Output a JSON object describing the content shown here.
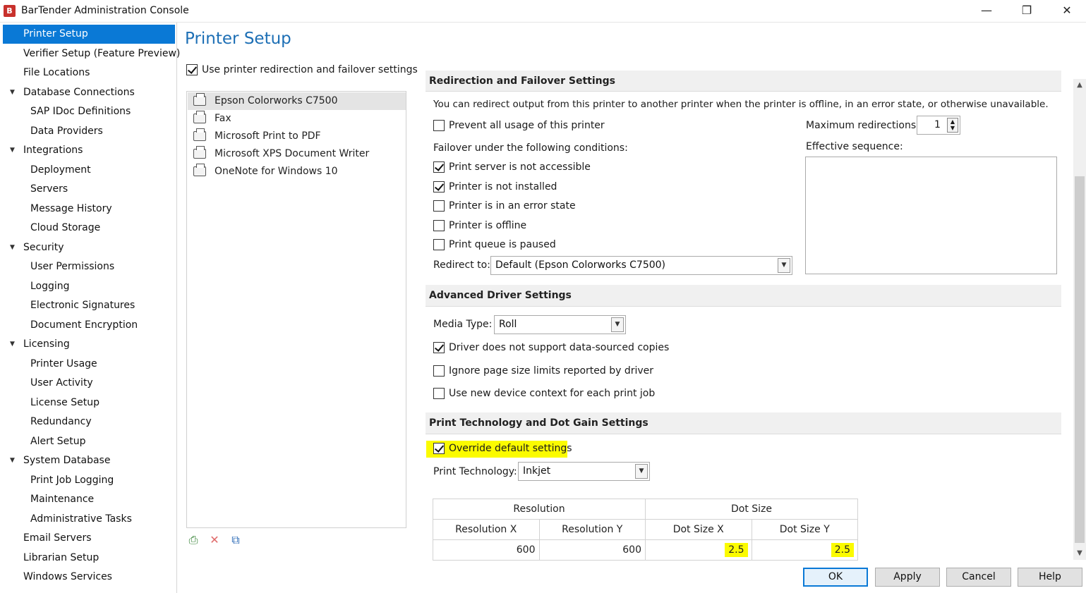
{
  "window": {
    "title": "BarTender Administration Console",
    "icon": "bartender-logo-icon",
    "controls": {
      "minimize": "—",
      "restore": "❐",
      "close": "✕"
    }
  },
  "sidebar": {
    "items": [
      {
        "label": "Printer Setup",
        "selected": true
      },
      {
        "label": "Verifier Setup (Feature Preview)"
      },
      {
        "label": "File Locations"
      },
      {
        "label": "Database Connections",
        "expanded": true
      },
      {
        "label": "SAP IDoc Definitions"
      },
      {
        "label": "Data Providers"
      },
      {
        "label": "Integrations",
        "expanded": true
      },
      {
        "label": "Deployment"
      },
      {
        "label": "Servers"
      },
      {
        "label": "Message History"
      },
      {
        "label": "Cloud Storage"
      },
      {
        "label": "Security",
        "expanded": true
      },
      {
        "label": "User Permissions"
      },
      {
        "label": "Logging"
      },
      {
        "label": "Electronic Signatures"
      },
      {
        "label": "Document Encryption"
      },
      {
        "label": "Licensing",
        "expanded": true
      },
      {
        "label": "Printer Usage"
      },
      {
        "label": "User Activity"
      },
      {
        "label": "License Setup"
      },
      {
        "label": "Redundancy"
      },
      {
        "label": "Alert Setup"
      },
      {
        "label": "System Database",
        "expanded": true
      },
      {
        "label": "Print Job Logging"
      },
      {
        "label": "Maintenance"
      },
      {
        "label": "Administrative Tasks"
      },
      {
        "label": "Email Servers"
      },
      {
        "label": "Librarian Setup"
      },
      {
        "label": "Windows Services"
      }
    ]
  },
  "main": {
    "title": "Printer Setup",
    "use_redirection_label": "Use printer redirection and failover settings",
    "use_redirection_checked": true,
    "printers": [
      {
        "name": "Epson Colorworks C7500",
        "selected": true
      },
      {
        "name": "Fax"
      },
      {
        "name": "Microsoft Print to PDF"
      },
      {
        "name": "Microsoft XPS Document Writer"
      },
      {
        "name": "OneNote for Windows 10"
      }
    ],
    "list_tools": {
      "add": "add-printer-icon",
      "delete": "delete-icon",
      "copy": "copy-icon"
    }
  },
  "redirection": {
    "header": "Redirection and Failover Settings",
    "description": "You can redirect output from this printer to another printer when the printer is offline, in an error state, or otherwise unavailable.",
    "prevent_label": "Prevent all usage of this printer",
    "prevent_checked": false,
    "max_redirections_label": "Maximum redirections:",
    "max_redirections_value": "1",
    "effective_sequence_label": "Effective sequence:",
    "failover_label": "Failover under the following conditions:",
    "conditions": [
      {
        "label": "Print server is not accessible",
        "checked": true
      },
      {
        "label": "Printer is not installed",
        "checked": true
      },
      {
        "label": "Printer is in an error state",
        "checked": false
      },
      {
        "label": "Printer is offline",
        "checked": false
      },
      {
        "label": "Print queue is paused",
        "checked": false
      }
    ],
    "redirect_to_label": "Redirect to:",
    "redirect_to_value": "Default (Epson Colorworks C7500)"
  },
  "advanced": {
    "header": "Advanced Driver Settings",
    "media_type_label": "Media Type:",
    "media_type_value": "Roll",
    "options": [
      {
        "label": "Driver does not support data-sourced copies",
        "checked": true
      },
      {
        "label": "Ignore page size limits reported by driver",
        "checked": false
      },
      {
        "label": "Use new device context for each print job",
        "checked": false
      }
    ]
  },
  "print_tech": {
    "header": "Print Technology and Dot Gain Settings",
    "override_label": "Override default settings",
    "override_checked": true,
    "tech_label": "Print Technology:",
    "tech_value": "Inkjet",
    "table": {
      "group_headers": [
        "Resolution",
        "Dot Size"
      ],
      "columns": [
        "Resolution X",
        "Resolution Y",
        "Dot Size X",
        "Dot Size Y"
      ],
      "values": [
        "600",
        "600",
        "2.5",
        "2.5"
      ]
    },
    "highlight_color": "#fbfb00"
  },
  "buttons": {
    "ok": "OK",
    "apply": "Apply",
    "cancel": "Cancel",
    "help": "Help"
  },
  "colors": {
    "accent": "#0a79d6",
    "title": "#1d6fb5"
  }
}
